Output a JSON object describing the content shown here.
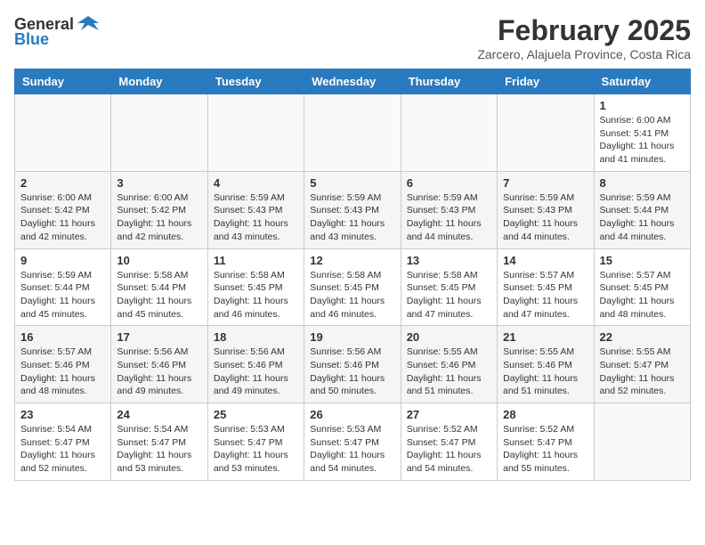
{
  "header": {
    "logo_general": "General",
    "logo_blue": "Blue",
    "month_title": "February 2025",
    "location": "Zarcero, Alajuela Province, Costa Rica"
  },
  "calendar": {
    "days_of_week": [
      "Sunday",
      "Monday",
      "Tuesday",
      "Wednesday",
      "Thursday",
      "Friday",
      "Saturday"
    ],
    "weeks": [
      [
        {
          "day": "",
          "info": ""
        },
        {
          "day": "",
          "info": ""
        },
        {
          "day": "",
          "info": ""
        },
        {
          "day": "",
          "info": ""
        },
        {
          "day": "",
          "info": ""
        },
        {
          "day": "",
          "info": ""
        },
        {
          "day": "1",
          "info": "Sunrise: 6:00 AM\nSunset: 5:41 PM\nDaylight: 11 hours\nand 41 minutes."
        }
      ],
      [
        {
          "day": "2",
          "info": "Sunrise: 6:00 AM\nSunset: 5:42 PM\nDaylight: 11 hours\nand 42 minutes."
        },
        {
          "day": "3",
          "info": "Sunrise: 6:00 AM\nSunset: 5:42 PM\nDaylight: 11 hours\nand 42 minutes."
        },
        {
          "day": "4",
          "info": "Sunrise: 5:59 AM\nSunset: 5:43 PM\nDaylight: 11 hours\nand 43 minutes."
        },
        {
          "day": "5",
          "info": "Sunrise: 5:59 AM\nSunset: 5:43 PM\nDaylight: 11 hours\nand 43 minutes."
        },
        {
          "day": "6",
          "info": "Sunrise: 5:59 AM\nSunset: 5:43 PM\nDaylight: 11 hours\nand 44 minutes."
        },
        {
          "day": "7",
          "info": "Sunrise: 5:59 AM\nSunset: 5:43 PM\nDaylight: 11 hours\nand 44 minutes."
        },
        {
          "day": "8",
          "info": "Sunrise: 5:59 AM\nSunset: 5:44 PM\nDaylight: 11 hours\nand 44 minutes."
        }
      ],
      [
        {
          "day": "9",
          "info": "Sunrise: 5:59 AM\nSunset: 5:44 PM\nDaylight: 11 hours\nand 45 minutes."
        },
        {
          "day": "10",
          "info": "Sunrise: 5:58 AM\nSunset: 5:44 PM\nDaylight: 11 hours\nand 45 minutes."
        },
        {
          "day": "11",
          "info": "Sunrise: 5:58 AM\nSunset: 5:45 PM\nDaylight: 11 hours\nand 46 minutes."
        },
        {
          "day": "12",
          "info": "Sunrise: 5:58 AM\nSunset: 5:45 PM\nDaylight: 11 hours\nand 46 minutes."
        },
        {
          "day": "13",
          "info": "Sunrise: 5:58 AM\nSunset: 5:45 PM\nDaylight: 11 hours\nand 47 minutes."
        },
        {
          "day": "14",
          "info": "Sunrise: 5:57 AM\nSunset: 5:45 PM\nDaylight: 11 hours\nand 47 minutes."
        },
        {
          "day": "15",
          "info": "Sunrise: 5:57 AM\nSunset: 5:45 PM\nDaylight: 11 hours\nand 48 minutes."
        }
      ],
      [
        {
          "day": "16",
          "info": "Sunrise: 5:57 AM\nSunset: 5:46 PM\nDaylight: 11 hours\nand 48 minutes."
        },
        {
          "day": "17",
          "info": "Sunrise: 5:56 AM\nSunset: 5:46 PM\nDaylight: 11 hours\nand 49 minutes."
        },
        {
          "day": "18",
          "info": "Sunrise: 5:56 AM\nSunset: 5:46 PM\nDaylight: 11 hours\nand 49 minutes."
        },
        {
          "day": "19",
          "info": "Sunrise: 5:56 AM\nSunset: 5:46 PM\nDaylight: 11 hours\nand 50 minutes."
        },
        {
          "day": "20",
          "info": "Sunrise: 5:55 AM\nSunset: 5:46 PM\nDaylight: 11 hours\nand 51 minutes."
        },
        {
          "day": "21",
          "info": "Sunrise: 5:55 AM\nSunset: 5:46 PM\nDaylight: 11 hours\nand 51 minutes."
        },
        {
          "day": "22",
          "info": "Sunrise: 5:55 AM\nSunset: 5:47 PM\nDaylight: 11 hours\nand 52 minutes."
        }
      ],
      [
        {
          "day": "23",
          "info": "Sunrise: 5:54 AM\nSunset: 5:47 PM\nDaylight: 11 hours\nand 52 minutes."
        },
        {
          "day": "24",
          "info": "Sunrise: 5:54 AM\nSunset: 5:47 PM\nDaylight: 11 hours\nand 53 minutes."
        },
        {
          "day": "25",
          "info": "Sunrise: 5:53 AM\nSunset: 5:47 PM\nDaylight: 11 hours\nand 53 minutes."
        },
        {
          "day": "26",
          "info": "Sunrise: 5:53 AM\nSunset: 5:47 PM\nDaylight: 11 hours\nand 54 minutes."
        },
        {
          "day": "27",
          "info": "Sunrise: 5:52 AM\nSunset: 5:47 PM\nDaylight: 11 hours\nand 54 minutes."
        },
        {
          "day": "28",
          "info": "Sunrise: 5:52 AM\nSunset: 5:47 PM\nDaylight: 11 hours\nand 55 minutes."
        },
        {
          "day": "",
          "info": ""
        }
      ]
    ]
  }
}
